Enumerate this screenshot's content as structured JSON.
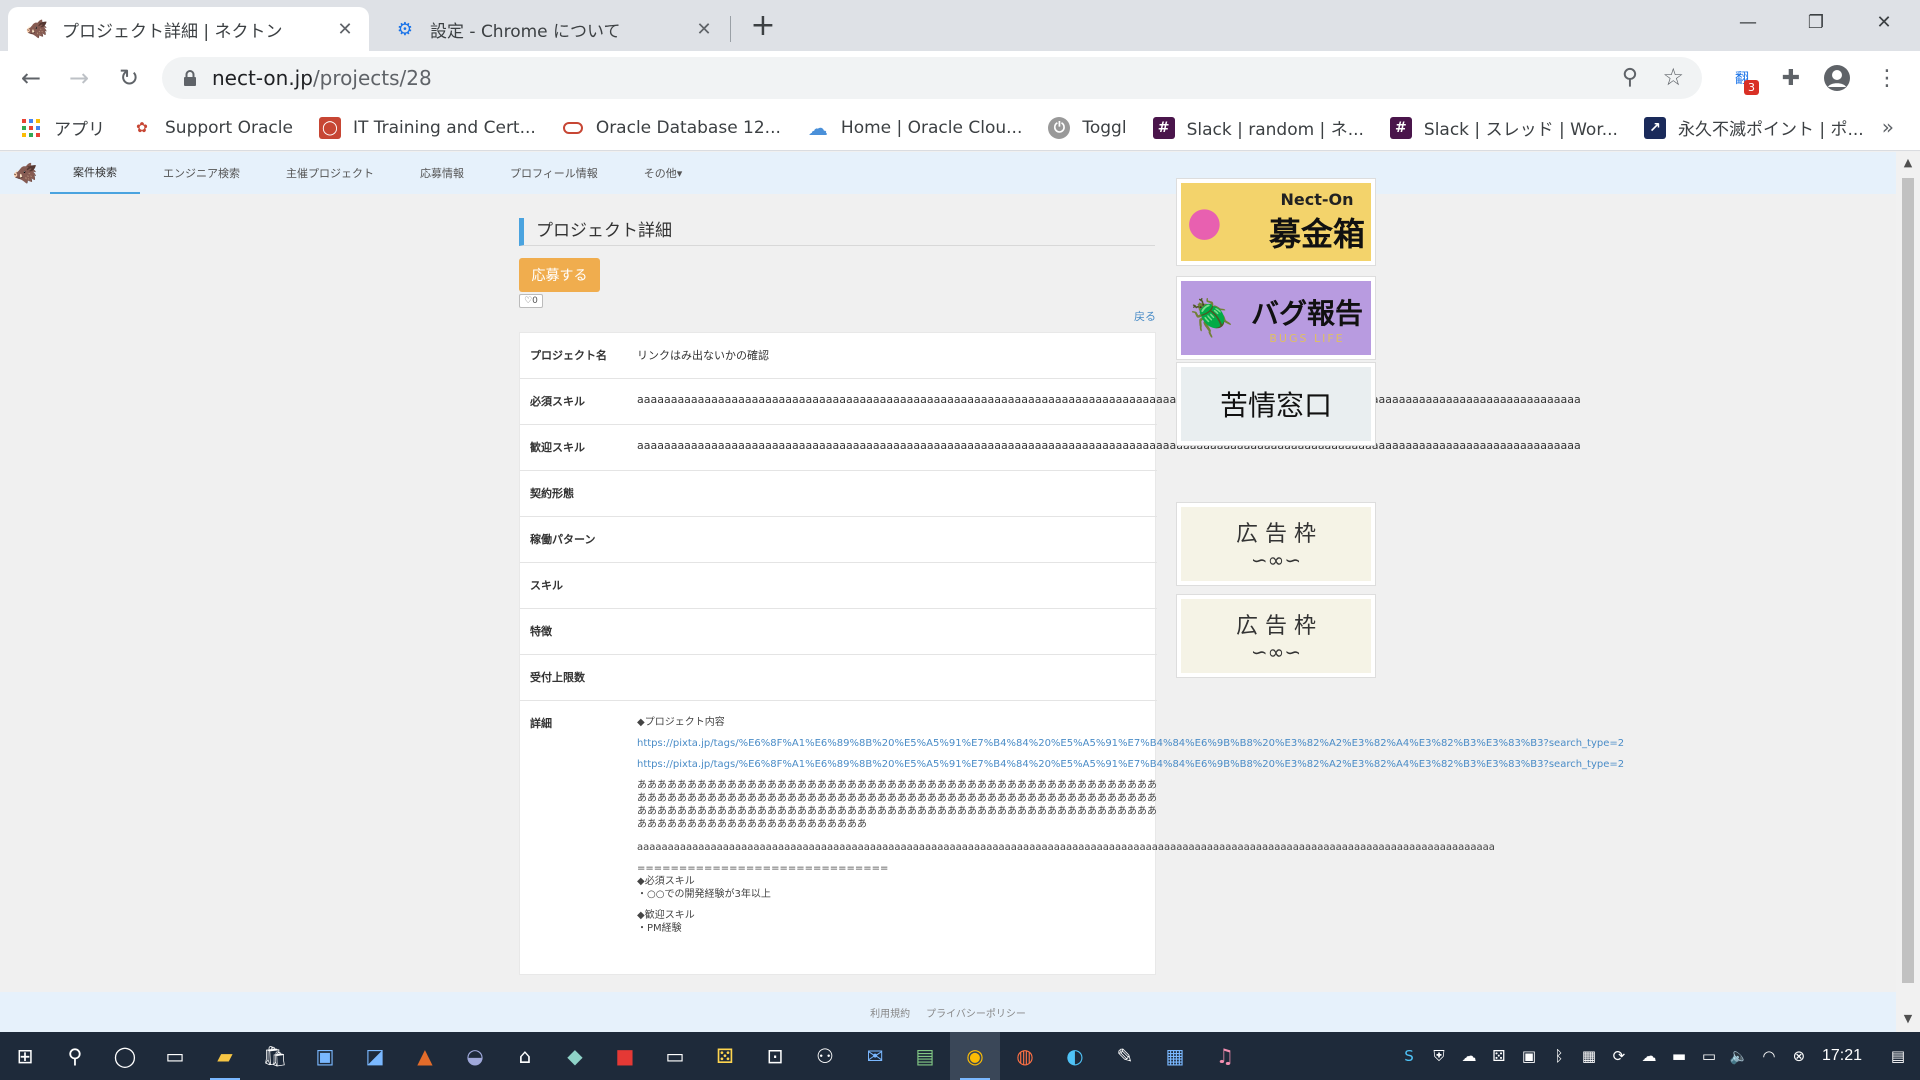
{
  "browser": {
    "tabs": [
      {
        "title": "プロジェクト詳細 | ネクトン",
        "favicon": "nekton-logo-icon"
      },
      {
        "title": "設定 - Chrome について",
        "favicon": "gear-icon"
      }
    ],
    "url_host": "nect-on.jp",
    "url_path": "/projects/28",
    "extension_badge": "3",
    "bookmarks": [
      {
        "label": "アプリ",
        "icon": "apps-grid-icon"
      },
      {
        "label": "Support Oracle",
        "icon": "oracle-support-icon"
      },
      {
        "label": "IT Training and Cert...",
        "icon": "oracle-red-icon"
      },
      {
        "label": "Oracle Database 12...",
        "icon": "oracle-ring-icon"
      },
      {
        "label": "Home | Oracle Clou...",
        "icon": "cloud-icon"
      },
      {
        "label": "Toggl",
        "icon": "power-icon"
      },
      {
        "label": "Slack | random | ネ...",
        "icon": "slack-icon"
      },
      {
        "label": "Slack | スレッド | Wor...",
        "icon": "slack-icon"
      },
      {
        "label": "永久不滅ポイント | ポ...",
        "icon": "chart-icon"
      }
    ]
  },
  "site": {
    "nav": [
      "案件検索",
      "エンジニア検索",
      "主催プロジェクト",
      "応募情報",
      "プロフィール情報",
      "その他▾"
    ],
    "page_title": "プロジェクト詳細",
    "apply_label": "応募する",
    "like_label": "♡0",
    "back_label": "戻る",
    "fields": [
      {
        "label": "プロジェクト名",
        "value": "リンクはみ出ないかの確認"
      },
      {
        "label": "必須スキル",
        "value": "aaaaaaaaaaaaaaaaaaaaaaaaaaaaaaaaaaaaaaaaaaaaaaaaaaaaaaaaaaaaaaaaaaaaaaaaaaaaaaaaaaaaaaaaaaaaaaaaaaaaaaaaaaaaaaaaaaaaaaaaaaaaaaaaaaaaaaaaaaaa"
      },
      {
        "label": "歓迎スキル",
        "value": "aaaaaaaaaaaaaaaaaaaaaaaaaaaaaaaaaaaaaaaaaaaaaaaaaaaaaaaaaaaaaaaaaaaaaaaaaaaaaaaaaaaaaaaaaaaaaaaaaaaaaaaaaaaaaaaaaaaaaaaaaaaaaaaaaaaaaaaaaaaa"
      },
      {
        "label": "契約形態",
        "value": ""
      },
      {
        "label": "稼働パターン",
        "value": ""
      },
      {
        "label": "スキル",
        "value": ""
      },
      {
        "label": "特徴",
        "value": ""
      },
      {
        "label": "受付上限数",
        "value": ""
      }
    ],
    "details_label": "詳細",
    "details": {
      "heading": "◆プロジェクト内容",
      "link1": "https://pixta.jp/tags/%E6%8F%A1%E6%89%8B%20%E5%A5%91%E7%B4%84%20%E5%A5%91%E7%B4%84%E6%9B%B8%20%E3%82%A2%E3%82%A4%E3%82%B3%E3%83%B3?search_type=2",
      "link2": "https://pixta.jp/tags/%E6%8F%A1%E6%89%8B%20%E5%A5%91%E7%B4%84%20%E5%A5%91%E7%B4%84%E6%9B%B8%20%E3%82%A2%E3%82%A4%E3%82%B3%E3%83%B3?search_type=2",
      "jp_text": "あああああああああああああああああああああああああああああああああああああああああああああああああああああああああああああああああああああああああああああああああああああああああああああああああああああああああああああああああああああああああああああああああああああああああああああああああああああああああああああああああああああああああああああああああああ",
      "long_a": "aaaaaaaaaaaaaaaaaaaaaaaaaaaaaaaaaaaaaaaaaaaaaaaaaaaaaaaaaaaaaaaaaaaaaaaaaaaaaaaaaaaaaaaaaaaaaaaaaaaaaaaaaaaaaaaaaaaaaaaaaaaaaaaaaaaaaaaaaaaa",
      "separator": "==============================",
      "req_heading": "◆必須スキル",
      "req_item": "・○○での開発経験が3年以上",
      "welcome_heading": "◆歓迎スキル",
      "welcome_item": "・PM経験"
    },
    "banners": [
      {
        "title": "Nect-On",
        "subtitle": "募金箱",
        "bg": "#f3d36b",
        "accent": "#e860b0"
      },
      {
        "title": "バグ報告",
        "subtitle": "BUGS LIFE",
        "bg": "#b89be0",
        "accent": "#222"
      },
      {
        "title": "苦情窓口",
        "bg": "#e9eef0"
      },
      {
        "title": "広 告 枠",
        "bg": "#f5f3e6"
      },
      {
        "title": "広 告 枠",
        "bg": "#f5f3e6"
      }
    ],
    "footer": [
      "利用規約",
      "プライバシーポリシー"
    ]
  },
  "taskbar": {
    "time": "17:21"
  }
}
